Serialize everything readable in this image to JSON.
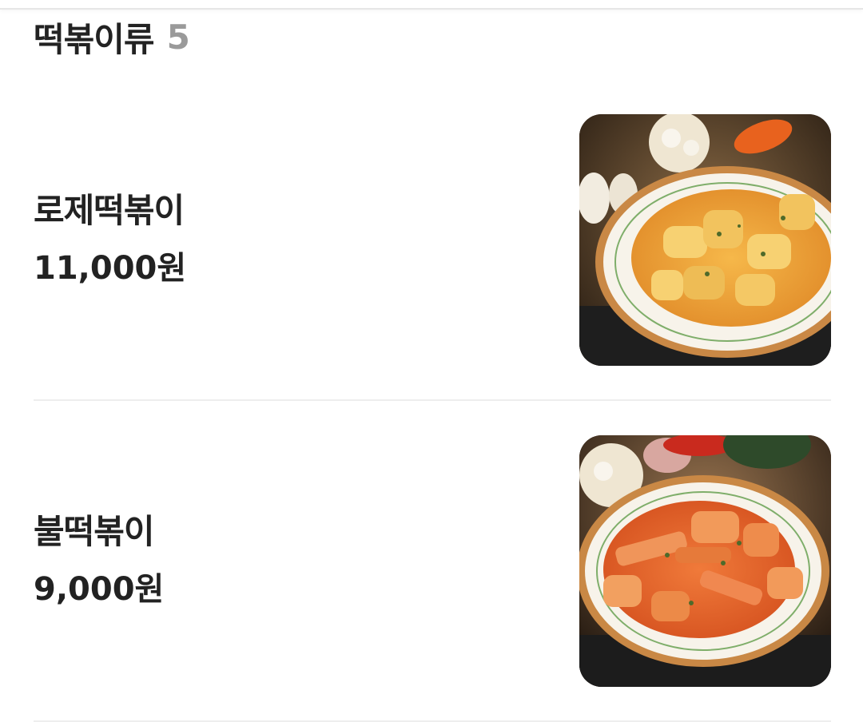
{
  "section": {
    "title": "떡볶이류",
    "count": "5"
  },
  "items": [
    {
      "name": "로제떡볶이",
      "price": "11,000원",
      "image_icon": "rose-tteokbokki-photo",
      "sauce_color": "#f0a23a"
    },
    {
      "name": "불떡볶이",
      "price": "9,000원",
      "image_icon": "spicy-tteokbokki-photo",
      "sauce_color": "#e2602a"
    }
  ]
}
